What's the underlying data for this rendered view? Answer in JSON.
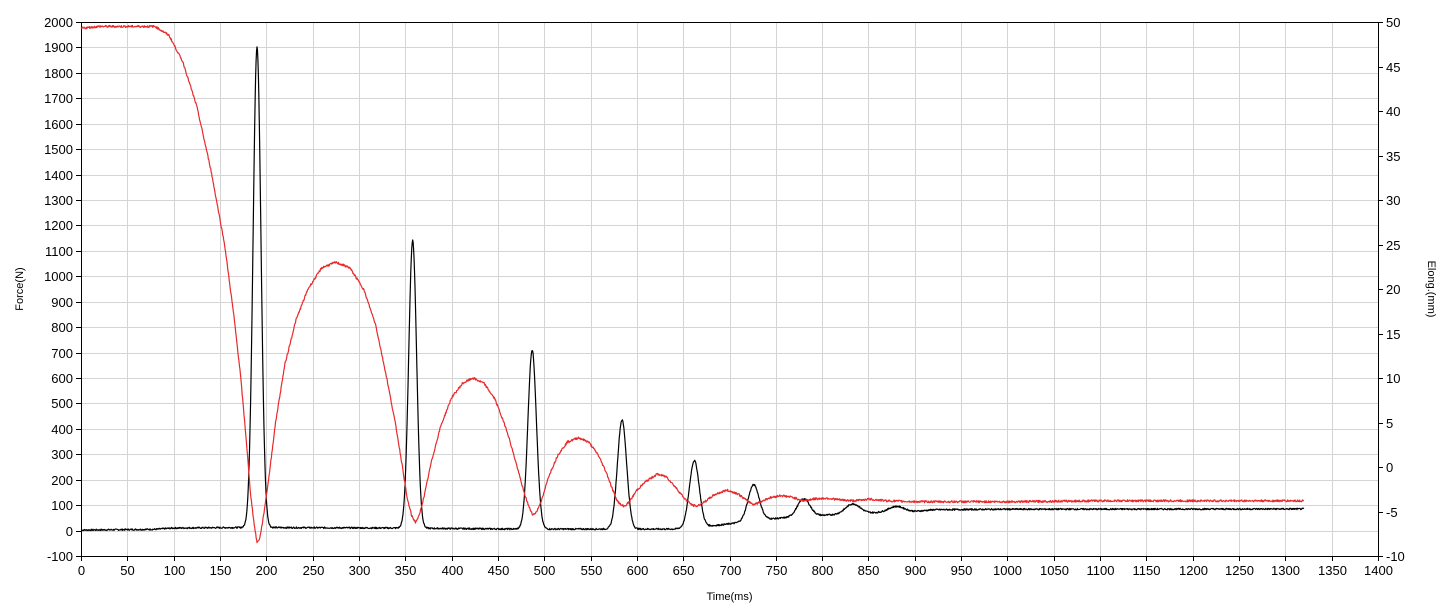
{
  "chart_data": {
    "type": "line",
    "title": "",
    "xlabel": "Time(ms)",
    "ylabel": "Force(N)",
    "y2label": "Elong.(mm)",
    "xlim": [
      0,
      1400
    ],
    "ylim": [
      -100,
      2000
    ],
    "y2lim": [
      -10,
      50
    ],
    "grid": true,
    "x_ticks": [
      0,
      50,
      100,
      150,
      200,
      250,
      300,
      350,
      400,
      450,
      500,
      550,
      600,
      650,
      700,
      750,
      800,
      850,
      900,
      950,
      1000,
      1050,
      1100,
      1150,
      1200,
      1250,
      1300,
      1350,
      1400
    ],
    "y_ticks": [
      -100,
      0,
      100,
      200,
      300,
      400,
      500,
      600,
      700,
      800,
      900,
      1000,
      1100,
      1200,
      1300,
      1400,
      1500,
      1600,
      1700,
      1800,
      1900,
      2000
    ],
    "y2_ticks": [
      -10,
      -5,
      0,
      5,
      10,
      15,
      20,
      25,
      30,
      35,
      40,
      45,
      50
    ],
    "series": [
      {
        "axis": "left",
        "color": "#000000",
        "baseline": [
          [
            0,
            2
          ],
          [
            80,
            5
          ],
          [
            100,
            10
          ],
          [
            170,
            12
          ],
          [
            200,
            12
          ],
          [
            340,
            10
          ],
          [
            400,
            8
          ],
          [
            470,
            6
          ],
          [
            580,
            6
          ],
          [
            640,
            6
          ],
          [
            690,
            22
          ],
          [
            740,
            45
          ],
          [
            790,
            58
          ],
          [
            840,
            68
          ],
          [
            880,
            73
          ],
          [
            900,
            75
          ],
          [
            920,
            82
          ],
          [
            960,
            83
          ],
          [
            1000,
            84
          ],
          [
            1320,
            85
          ]
        ],
        "peaks": [
          {
            "x": 190,
            "y": 1900,
            "w": 6
          },
          {
            "x": 358,
            "y": 1140,
            "w": 6
          },
          {
            "x": 487,
            "y": 710,
            "w": 6.5
          },
          {
            "x": 584,
            "y": 435,
            "w": 7
          },
          {
            "x": 662,
            "y": 275,
            "w": 7.5
          },
          {
            "x": 726,
            "y": 180,
            "w": 8.5
          },
          {
            "x": 780,
            "y": 125,
            "w": 9.5
          },
          {
            "x": 833,
            "y": 105,
            "w": 11
          },
          {
            "x": 880,
            "y": 95,
            "w": 12
          }
        ],
        "x_end": 1320,
        "noise": 3
      },
      {
        "axis": "right",
        "color": "#e8292b",
        "points": [
          [
            0,
            49.3
          ],
          [
            20,
            49.5
          ],
          [
            60,
            49.5
          ],
          [
            80,
            49.5
          ],
          [
            95,
            48.5
          ],
          [
            110,
            45.5
          ],
          [
            125,
            40.5
          ],
          [
            140,
            33.5
          ],
          [
            155,
            25
          ],
          [
            165,
            17
          ],
          [
            172,
            10.5
          ],
          [
            178,
            3.5
          ],
          [
            183,
            -3
          ],
          [
            187,
            -6.5
          ],
          [
            190,
            -8.5
          ],
          [
            193,
            -8.0
          ],
          [
            197,
            -5.5
          ],
          [
            203,
            -1
          ],
          [
            210,
            5
          ],
          [
            220,
            11.5
          ],
          [
            232,
            16.5
          ],
          [
            245,
            20.0
          ],
          [
            260,
            22.4
          ],
          [
            275,
            23.0
          ],
          [
            290,
            22.4
          ],
          [
            305,
            20.0
          ],
          [
            318,
            16.0
          ],
          [
            330,
            10.0
          ],
          [
            340,
            4.5
          ],
          [
            347,
            0
          ],
          [
            352,
            -3.5
          ],
          [
            357,
            -5.5
          ],
          [
            361,
            -6.2
          ],
          [
            365,
            -5.5
          ],
          [
            371,
            -3.0
          ],
          [
            378,
            0.5
          ],
          [
            388,
            4.5
          ],
          [
            400,
            7.8
          ],
          [
            412,
            9.4
          ],
          [
            423,
            10.0
          ],
          [
            435,
            9.4
          ],
          [
            447,
            7.6
          ],
          [
            460,
            4.0
          ],
          [
            470,
            0.3
          ],
          [
            478,
            -2.8
          ],
          [
            484,
            -4.6
          ],
          [
            488,
            -5.4
          ],
          [
            492,
            -5.0
          ],
          [
            498,
            -3.5
          ],
          [
            505,
            -1.0
          ],
          [
            515,
            1.4
          ],
          [
            525,
            2.8
          ],
          [
            537,
            3.3
          ],
          [
            548,
            2.8
          ],
          [
            558,
            1.4
          ],
          [
            567,
            -0.6
          ],
          [
            574,
            -2.6
          ],
          [
            579,
            -3.8
          ],
          [
            583,
            -4.3
          ],
          [
            587,
            -4.4
          ],
          [
            592,
            -3.9
          ],
          [
            600,
            -2.6
          ],
          [
            610,
            -1.6
          ],
          [
            622,
            -0.8
          ],
          [
            632,
            -1.1
          ],
          [
            642,
            -2.3
          ],
          [
            652,
            -3.6
          ],
          [
            660,
            -4.3
          ],
          [
            665,
            -4.4
          ],
          [
            672,
            -4.0
          ],
          [
            684,
            -3.1
          ],
          [
            697,
            -2.6
          ],
          [
            709,
            -3.0
          ],
          [
            719,
            -3.8
          ],
          [
            726,
            -4.2
          ],
          [
            732,
            -4.0
          ],
          [
            742,
            -3.5
          ],
          [
            755,
            -3.2
          ],
          [
            768,
            -3.4
          ],
          [
            780,
            -3.8
          ],
          [
            790,
            -3.6
          ],
          [
            805,
            -3.5
          ],
          [
            820,
            -3.7
          ],
          [
            835,
            -3.8
          ],
          [
            850,
            -3.6
          ],
          [
            870,
            -3.8
          ],
          [
            900,
            -3.9
          ],
          [
            950,
            -3.9
          ],
          [
            1000,
            -3.9
          ],
          [
            1100,
            -3.8
          ],
          [
            1200,
            -3.8
          ],
          [
            1320,
            -3.8
          ]
        ],
        "noise": 0.12
      }
    ]
  }
}
